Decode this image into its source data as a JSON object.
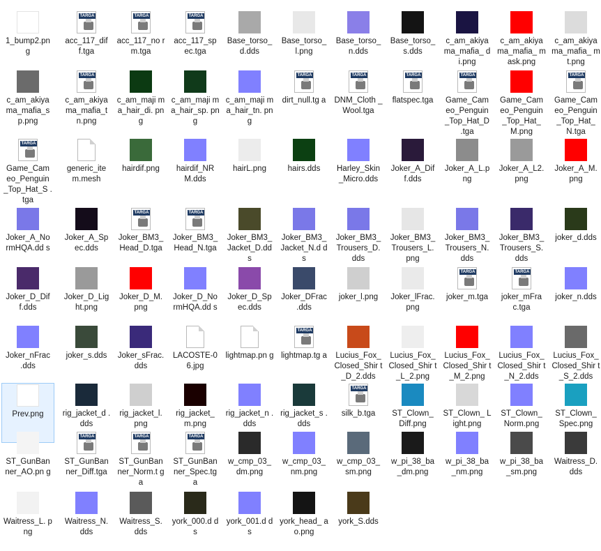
{
  "files": [
    {
      "name": "1_bump2.png",
      "icon": "image-thumbnail",
      "color": "#ffffff",
      "row": 0,
      "col": 0
    },
    {
      "name": "acc_117_dif f.tga",
      "icon": "targa-file-icon",
      "color": "#ffffff",
      "row": 0,
      "col": 1
    },
    {
      "name": "acc_117_no rm.tga",
      "icon": "targa-file-icon",
      "color": "#ffffff",
      "row": 0,
      "col": 2
    },
    {
      "name": "acc_117_sp ec.tga",
      "icon": "targa-file-icon",
      "color": "#ffffff",
      "row": 0,
      "col": 3
    },
    {
      "name": "Base_torso_ d.dds",
      "icon": "image-thumbnail",
      "color": "#a9a9a9",
      "row": 0,
      "col": 4
    },
    {
      "name": "Base_torso_ l.png",
      "icon": "image-thumbnail",
      "color": "#e8e8e8",
      "row": 0,
      "col": 5
    },
    {
      "name": "Base_torso_ n.dds",
      "icon": "image-thumbnail",
      "color": "#8a7fe8",
      "row": 0,
      "col": 6
    },
    {
      "name": "Base_torso_ s.dds",
      "icon": "image-thumbnail",
      "color": "#141414",
      "row": 0,
      "col": 7
    },
    {
      "name": "c_am_akiya ma_mafia_ di.png",
      "icon": "image-thumbnail",
      "color": "#1a1442",
      "row": 0,
      "col": 8
    },
    {
      "name": "c_am_akiya ma_mafia_ mask.png",
      "icon": "image-thumbnail",
      "color": "#ff0000",
      "row": 0,
      "col": 9
    },
    {
      "name": "c_am_akiya ma_mafia_ mt.png",
      "icon": "image-thumbnail",
      "color": "#dcdcdc",
      "row": 0,
      "col": 10
    },
    {
      "name": "c_am_akiya ma_mafia_s p.png",
      "icon": "image-thumbnail",
      "color": "#6b6b6b",
      "row": 1,
      "col": 0
    },
    {
      "name": "c_am_akiya ma_mafia_t n.png",
      "icon": "targa-file-icon",
      "color": "#ffffff",
      "row": 1,
      "col": 1
    },
    {
      "name": "c_am_maji ma_hair_di. png",
      "icon": "image-thumbnail",
      "color": "#0c3a12",
      "row": 1,
      "col": 2
    },
    {
      "name": "c_am_maji ma_hair_sp. png",
      "icon": "image-thumbnail",
      "color": "#103a1a",
      "row": 1,
      "col": 3
    },
    {
      "name": "c_am_maji ma_hair_tn. png",
      "icon": "image-thumbnail",
      "color": "#8080ff",
      "row": 1,
      "col": 4
    },
    {
      "name": "dirt_null.tg a",
      "icon": "targa-file-icon",
      "color": "#ffffff",
      "row": 1,
      "col": 5
    },
    {
      "name": "DNM_Cloth _Wool.tga",
      "icon": "targa-file-icon",
      "color": "#ffffff",
      "row": 1,
      "col": 6
    },
    {
      "name": "flatspec.tga",
      "icon": "targa-file-icon",
      "color": "#ffffff",
      "row": 1,
      "col": 7
    },
    {
      "name": "Game_Cam eo_Penguin _Top_Hat_D .tga",
      "icon": "targa-file-icon",
      "color": "#ffffff",
      "row": 1,
      "col": 8
    },
    {
      "name": "Game_Cam eo_Penguin _Top_Hat_ M.png",
      "icon": "image-thumbnail",
      "color": "#ff0000",
      "row": 1,
      "col": 9
    },
    {
      "name": "Game_Cam eo_Penguin _Top_Hat_ N.tga",
      "icon": "targa-file-icon",
      "color": "#ffffff",
      "row": 1,
      "col": 10
    },
    {
      "name": "Game_Cam eo_Penguin _Top_Hat_S .tga",
      "icon": "targa-file-icon",
      "color": "#ffffff",
      "row": 2,
      "col": 0
    },
    {
      "name": "generic_ite m.mesh",
      "icon": "blank-document-icon",
      "color": "#ffffff",
      "row": 2,
      "col": 1
    },
    {
      "name": "hairdif.png",
      "icon": "image-thumbnail",
      "color": "#3a6a3a",
      "row": 2,
      "col": 2
    },
    {
      "name": "hairdif_NR M.dds",
      "icon": "image-thumbnail",
      "color": "#8080ff",
      "row": 2,
      "col": 3
    },
    {
      "name": "hairL.png",
      "icon": "image-thumbnail",
      "color": "#ececec",
      "row": 2,
      "col": 4
    },
    {
      "name": "hairs.dds",
      "icon": "image-thumbnail",
      "color": "#0c4012",
      "row": 2,
      "col": 5
    },
    {
      "name": "Harley_Skin _Micro.dds",
      "icon": "image-thumbnail",
      "color": "#8080ff",
      "row": 2,
      "col": 6
    },
    {
      "name": "Joker_A_Dif f.dds",
      "icon": "image-thumbnail",
      "color": "#2a1a3a",
      "row": 2,
      "col": 7
    },
    {
      "name": "Joker_A_L.p ng",
      "icon": "image-thumbnail",
      "color": "#8c8c8c",
      "row": 2,
      "col": 8
    },
    {
      "name": "Joker_A_L2. png",
      "icon": "image-thumbnail",
      "color": "#9a9a9a",
      "row": 2,
      "col": 9
    },
    {
      "name": "Joker_A_M. png",
      "icon": "image-thumbnail",
      "color": "#ff0000",
      "row": 2,
      "col": 10
    },
    {
      "name": "Joker_A_No rmHQA.dd s",
      "icon": "image-thumbnail",
      "color": "#7a78e8",
      "row": 3,
      "col": 0
    },
    {
      "name": "Joker_A_Sp ec.dds",
      "icon": "image-thumbnail",
      "color": "#140c1a",
      "row": 3,
      "col": 1
    },
    {
      "name": "Joker_BM3_ Head_D.tga",
      "icon": "targa-file-icon",
      "color": "#ffffff",
      "row": 3,
      "col": 2
    },
    {
      "name": "Joker_BM3_ Head_N.tga",
      "icon": "targa-file-icon",
      "color": "#ffffff",
      "row": 3,
      "col": 3
    },
    {
      "name": "Joker_BM3_ Jacket_D.dd s",
      "icon": "image-thumbnail",
      "color": "#4a4a2a",
      "row": 3,
      "col": 4
    },
    {
      "name": "Joker_BM3_ Jacket_N.d ds",
      "icon": "image-thumbnail",
      "color": "#7a78e8",
      "row": 3,
      "col": 5
    },
    {
      "name": "Joker_BM3_ Trousers_D. dds",
      "icon": "image-thumbnail",
      "color": "#7a78e8",
      "row": 3,
      "col": 6
    },
    {
      "name": "Joker_BM3_ Trousers_L. png",
      "icon": "image-thumbnail",
      "color": "#e6e6e6",
      "row": 3,
      "col": 7
    },
    {
      "name": "Joker_BM3_ Trousers_N. dds",
      "icon": "image-thumbnail",
      "color": "#7a78e8",
      "row": 3,
      "col": 8
    },
    {
      "name": "Joker_BM3_ Trousers_S. dds",
      "icon": "image-thumbnail",
      "color": "#3a2a6a",
      "row": 3,
      "col": 9
    },
    {
      "name": "joker_d.dds",
      "icon": "image-thumbnail",
      "color": "#2a3a1a",
      "row": 3,
      "col": 10
    },
    {
      "name": "Joker_D_Dif f.dds",
      "icon": "image-thumbnail",
      "color": "#4a2a6a",
      "row": 4,
      "col": 0
    },
    {
      "name": "Joker_D_Lig ht.png",
      "icon": "image-thumbnail",
      "color": "#9a9a9a",
      "row": 4,
      "col": 1
    },
    {
      "name": "Joker_D_M. png",
      "icon": "image-thumbnail",
      "color": "#ff0000",
      "row": 4,
      "col": 2
    },
    {
      "name": "Joker_D_No rmHQA.dd s",
      "icon": "image-thumbnail",
      "color": "#8080ff",
      "row": 4,
      "col": 3
    },
    {
      "name": "Joker_D_Sp ec.dds",
      "icon": "image-thumbnail",
      "color": "#8a4aaa",
      "row": 4,
      "col": 4
    },
    {
      "name": "Joker_DFrac .dds",
      "icon": "image-thumbnail",
      "color": "#3a4a6a",
      "row": 4,
      "col": 5
    },
    {
      "name": "joker_l.png",
      "icon": "image-thumbnail",
      "color": "#cfcfcf",
      "row": 4,
      "col": 6
    },
    {
      "name": "Joker_lFrac. png",
      "icon": "image-thumbnail",
      "color": "#eaeaea",
      "row": 4,
      "col": 7
    },
    {
      "name": "joker_m.tga",
      "icon": "targa-file-icon",
      "color": "#ffffff",
      "row": 4,
      "col": 8
    },
    {
      "name": "joker_mFra c.tga",
      "icon": "targa-file-icon",
      "color": "#ffffff",
      "row": 4,
      "col": 9
    },
    {
      "name": "joker_n.dds",
      "icon": "image-thumbnail",
      "color": "#8080ff",
      "row": 4,
      "col": 10
    },
    {
      "name": "Joker_nFrac .dds",
      "icon": "image-thumbnail",
      "color": "#8080ff",
      "row": 5,
      "col": 0
    },
    {
      "name": "joker_s.dds",
      "icon": "image-thumbnail",
      "color": "#3a4a3a",
      "row": 5,
      "col": 1
    },
    {
      "name": "Joker_sFrac. dds",
      "icon": "image-thumbnail",
      "color": "#3a2a7a",
      "row": 5,
      "col": 2
    },
    {
      "name": "LACOSTE-0 6.jpg",
      "icon": "blank-document-icon",
      "color": "#ffffff",
      "row": 5,
      "col": 3
    },
    {
      "name": "lightmap.pn g",
      "icon": "blank-document-icon",
      "color": "#ffffff",
      "row": 5,
      "col": 4
    },
    {
      "name": "lightmap.tg a",
      "icon": "targa-file-icon",
      "color": "#ffffff",
      "row": 5,
      "col": 5
    },
    {
      "name": "Lucius_Fox_ Closed_Shir t_D_2.dds",
      "icon": "image-thumbnail",
      "color": "#c84a1a",
      "row": 5,
      "col": 6
    },
    {
      "name": "Lucius_Fox_ Closed_Shir t_L_2.png",
      "icon": "image-thumbnail",
      "color": "#eeeeee",
      "row": 5,
      "col": 7
    },
    {
      "name": "Lucius_Fox_ Closed_Shir t_M_2.png",
      "icon": "image-thumbnail",
      "color": "#ff0000",
      "row": 5,
      "col": 8
    },
    {
      "name": "Lucius_Fox_ Closed_Shir t_N_2.dds",
      "icon": "image-thumbnail",
      "color": "#8080ff",
      "row": 5,
      "col": 9
    },
    {
      "name": "Lucius_Fox_ Closed_Shir t_S_2.dds",
      "icon": "image-thumbnail",
      "color": "#6a6a6a",
      "row": 5,
      "col": 10
    },
    {
      "name": "Prev.png",
      "icon": "image-thumbnail",
      "color": "#ffffff",
      "row": 6,
      "col": 0
    },
    {
      "name": "rig_jacket_d .dds",
      "icon": "image-thumbnail",
      "color": "#1a2a3a",
      "row": 6,
      "col": 1
    },
    {
      "name": "rig_jacket_l. png",
      "icon": "image-thumbnail",
      "color": "#cfcfcf",
      "row": 6,
      "col": 2
    },
    {
      "name": "rig_jacket_ m.png",
      "icon": "image-thumbnail",
      "color": "#1a0000",
      "row": 6,
      "col": 3
    },
    {
      "name": "rig_jacket_n .dds",
      "icon": "image-thumbnail",
      "color": "#8080ff",
      "row": 6,
      "col": 4
    },
    {
      "name": "rig_jacket_s .dds",
      "icon": "image-thumbnail",
      "color": "#1a3a3a",
      "row": 6,
      "col": 5
    },
    {
      "name": "silk_b.tga",
      "icon": "targa-file-icon",
      "color": "#ffffff",
      "row": 6,
      "col": 6
    },
    {
      "name": "ST_Clown_ Diff.png",
      "icon": "image-thumbnail",
      "color": "#1a8ac0",
      "row": 6,
      "col": 7
    },
    {
      "name": "ST_Clown_ Light.png",
      "icon": "image-thumbnail",
      "color": "#d8d8d8",
      "row": 6,
      "col": 8
    },
    {
      "name": "ST_Clown_ Norm.png",
      "icon": "image-thumbnail",
      "color": "#8080ff",
      "row": 6,
      "col": 9
    },
    {
      "name": "ST_Clown_ Spec.png",
      "icon": "image-thumbnail",
      "color": "#1aa0c0",
      "row": 6,
      "col": 10
    },
    {
      "name": "ST_GunBan ner_AO.pn g",
      "icon": "image-thumbnail",
      "color": "#f4f4f4",
      "row": 7,
      "col": 0
    },
    {
      "name": "ST_GunBan ner_Diff.tga",
      "icon": "targa-file-icon",
      "color": "#ffffff",
      "row": 7,
      "col": 1
    },
    {
      "name": "ST_GunBan ner_Norm.t ga",
      "icon": "targa-file-icon",
      "color": "#ffffff",
      "row": 7,
      "col": 2
    },
    {
      "name": "ST_GunBan ner_Spec.tg a",
      "icon": "targa-file-icon",
      "color": "#ffffff",
      "row": 7,
      "col": 3
    },
    {
      "name": "w_cmp_03_ dm.png",
      "icon": "image-thumbnail",
      "color": "#2a2a2a",
      "row": 7,
      "col": 4
    },
    {
      "name": "w_cmp_03_ nm.png",
      "icon": "image-thumbnail",
      "color": "#8080ff",
      "row": 7,
      "col": 5
    },
    {
      "name": "w_cmp_03_ sm.png",
      "icon": "image-thumbnail",
      "color": "#5a6a7a",
      "row": 7,
      "col": 6
    },
    {
      "name": "w_pi_38_ba _dm.png",
      "icon": "image-thumbnail",
      "color": "#1a1a1a",
      "row": 7,
      "col": 7
    },
    {
      "name": "w_pi_38_ba _nm.png",
      "icon": "image-thumbnail",
      "color": "#8080ff",
      "row": 7,
      "col": 8
    },
    {
      "name": "w_pi_38_ba _sm.png",
      "icon": "image-thumbnail",
      "color": "#4a4a4a",
      "row": 7,
      "col": 9
    },
    {
      "name": "Waitress_D. dds",
      "icon": "image-thumbnail",
      "color": "#3a3a3a",
      "row": 7,
      "col": 10
    },
    {
      "name": "Waitress_L. png",
      "icon": "image-thumbnail",
      "color": "#f2f2f2",
      "row": 8,
      "col": 0
    },
    {
      "name": "Waitress_N. dds",
      "icon": "image-thumbnail",
      "color": "#8080ff",
      "row": 8,
      "col": 1
    },
    {
      "name": "Waitress_S. dds",
      "icon": "image-thumbnail",
      "color": "#5a5a5a",
      "row": 8,
      "col": 2
    },
    {
      "name": "york_000.d ds",
      "icon": "image-thumbnail",
      "color": "#2a2a1a",
      "row": 8,
      "col": 3
    },
    {
      "name": "york_001.d ds",
      "icon": "image-thumbnail",
      "color": "#8080ff",
      "row": 8,
      "col": 4
    },
    {
      "name": "york_head_ ao.png",
      "icon": "image-thumbnail",
      "color": "#141414",
      "row": 8,
      "col": 5
    },
    {
      "name": "york_S.dds",
      "icon": "image-thumbnail",
      "color": "#4a3a1a",
      "row": 8,
      "col": 6
    }
  ],
  "selected_file": "Prev.png"
}
